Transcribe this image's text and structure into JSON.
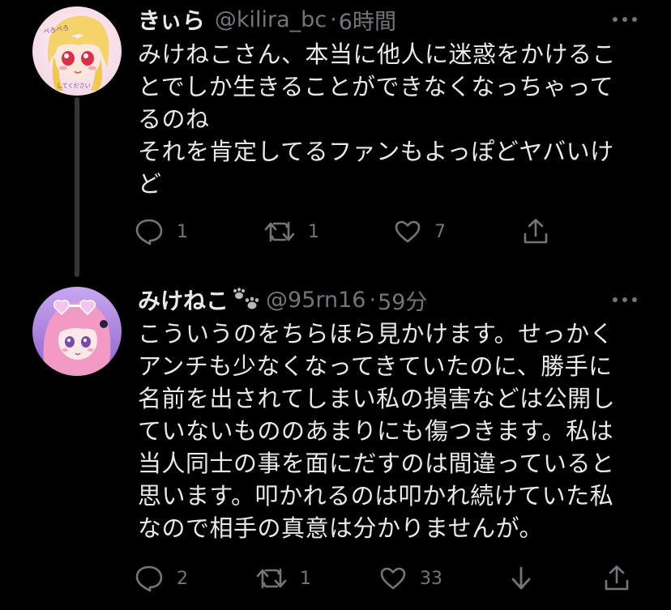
{
  "tweets": [
    {
      "name": "きぃら",
      "handle": "@kilira_bc",
      "separator": "·",
      "time": "6時間",
      "body_lines": [
        "みけねこさん、本当に他人に迷惑をかけるこ",
        "とでしか生きることができなくなっちゃって",
        "るのね",
        "それを肯定してるファンもよっぽどヤバいけ",
        "ど"
      ],
      "replies": "1",
      "retweets": "1",
      "likes": "7",
      "avatar_icon": "avatar-blonde-girl",
      "avatar_text_top": "ぺろぺろ",
      "avatar_text_bottom": "してください"
    },
    {
      "name": "みけねこ",
      "handle": "@95rn16",
      "separator": "·",
      "time": "59分",
      "body_lines": [
        "こういうのをちらほら見かけます。せっかく",
        "アンチも少なくなってきていたのに、勝手に",
        "名前を出されてしまい私の損害などは公開し",
        "ていないもののあまりにも傷つきます。私は",
        "当人同士の事を面にだすのは間違っていると",
        "思います。叩かれるのは叩かれ続けていた私",
        "なので相手の真意は分かりませんが。"
      ],
      "replies": "2",
      "retweets": "1",
      "likes": "33",
      "avatar_icon": "avatar-pink-hair-girl",
      "name_emoji": "paw-prints-icon"
    }
  ],
  "colors": {
    "background": "#000000",
    "text": "#e7e9ea",
    "muted": "#71767b",
    "thread_line": "#333639"
  }
}
